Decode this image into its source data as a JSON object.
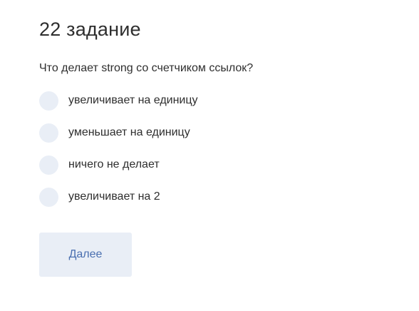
{
  "quiz": {
    "title": "22 задание",
    "question": "Что делает strong со счетчиком ссылок?",
    "options": [
      {
        "label": "увеличивает на единицу"
      },
      {
        "label": "уменьшает на единицу"
      },
      {
        "label": "ничего не делает"
      },
      {
        "label": "увеличивает на 2"
      }
    ],
    "next_label": "Далее"
  },
  "colors": {
    "radio_background": "#e9eef6",
    "button_background": "#e9eef6",
    "button_text": "#4a6fb0",
    "text": "#2e2e2e"
  }
}
